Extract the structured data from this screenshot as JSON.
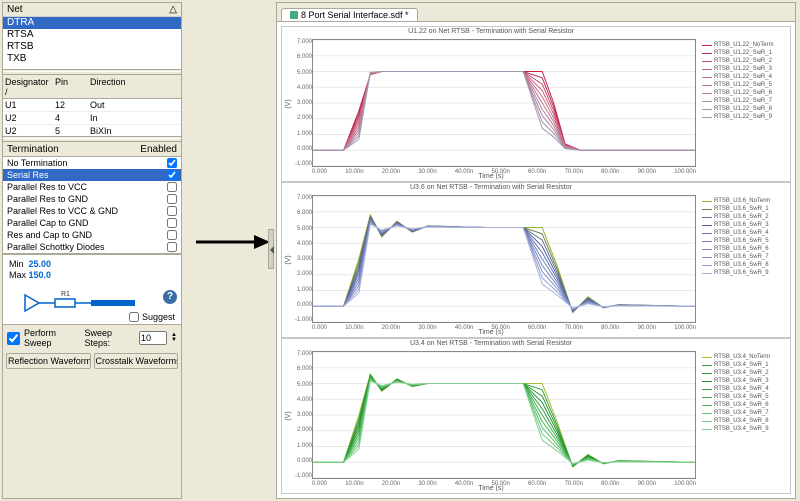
{
  "left": {
    "net_header": "Net",
    "nets": [
      "DTRA",
      "RTSA",
      "RTSB",
      "TXB"
    ],
    "net_selected": 0,
    "designator_headers": {
      "des": "Designator",
      "pin": "Pin",
      "dir": "Direction",
      "sort": "/"
    },
    "designator_rows": [
      {
        "des": "U1",
        "pin": "12",
        "dir": "Out"
      },
      {
        "des": "U2",
        "pin": "4",
        "dir": "In"
      },
      {
        "des": "U2",
        "pin": "5",
        "dir": "BiXIn"
      }
    ],
    "termination_headers": {
      "name": "Termination",
      "enabled": "Enabled"
    },
    "terminations": [
      {
        "name": "No Termination",
        "enabled": true,
        "selected": false
      },
      {
        "name": "Serial Res",
        "enabled": true,
        "selected": true
      },
      {
        "name": "Parallel Res to VCC",
        "enabled": false,
        "selected": false
      },
      {
        "name": "Parallel Res to GND",
        "enabled": false,
        "selected": false
      },
      {
        "name": "Parallel Res to VCC & GND",
        "enabled": false,
        "selected": false
      },
      {
        "name": "Parallel Cap to GND",
        "enabled": false,
        "selected": false
      },
      {
        "name": "Res and Cap to GND",
        "enabled": false,
        "selected": false
      },
      {
        "name": "Parallel Schottky Diodes",
        "enabled": false,
        "selected": false
      }
    ],
    "schematic": {
      "min_label": "Min",
      "min_val": "25.00",
      "max_label": "Max",
      "max_val": "150.0",
      "ref": "R1",
      "suggest_label": "Suggest",
      "suggest_checked": false
    },
    "sweep": {
      "perform_label": "Perform Sweep",
      "perform_checked": true,
      "steps_label": "Sweep Steps:",
      "steps_value": "10"
    },
    "buttons": {
      "reflection": "Reflection Waveforms...",
      "crosstalk": "Crosstalk Waveforms..."
    }
  },
  "right": {
    "tab_title": "8 Port Serial Interface.sdf *"
  },
  "chart_data": [
    {
      "type": "line",
      "title": "U1.22 on Net RTSB - Termination with Serial Resistor",
      "xlabel": "Time (s)",
      "ylabel": "(V)",
      "ylim": [
        -1.0,
        7.0
      ],
      "xlim": [
        0,
        100
      ],
      "yticks": [
        "7.000",
        "6.000",
        "5.000",
        "4.000",
        "3.000",
        "2.000",
        "1.000",
        "0.000",
        "-1.000"
      ],
      "xticks": [
        "0.000",
        "10.00n",
        "20.00n",
        "30.00n",
        "40.00n",
        "50.00n",
        "60.00n",
        "70.00n",
        "80.00n",
        "90.00n",
        "100.00n"
      ],
      "x": [
        0,
        8,
        12,
        15,
        18,
        25,
        35,
        45,
        55,
        60,
        63,
        66,
        70,
        80,
        100
      ],
      "values": [
        0,
        0,
        2.5,
        4.8,
        5.0,
        5.0,
        5.0,
        5.0,
        5.0,
        5.0,
        3.0,
        0.4,
        0.0,
        0.0,
        0.0
      ],
      "series_names": [
        "RTSB_U1.22_NoTerm",
        "RTSB_U1.22_SwR_1",
        "RTSB_U1.22_SwR_2",
        "RTSB_U1.22_SwR_3",
        "RTSB_U1.22_SwR_4",
        "RTSB_U1.22_SwR_5",
        "RTSB_U1.22_SwR_6",
        "RTSB_U1.22_SwR_7",
        "RTSB_U1.22_SwR_8",
        "RTSB_U1.22_SwR_9"
      ],
      "palette": [
        "#d02040",
        "#b03060",
        "#c85070",
        "#d06080",
        "#cc7088",
        "#c07890",
        "#b88098",
        "#b088a0",
        "#a890a8",
        "#a098b0"
      ]
    },
    {
      "type": "line",
      "title": "U3.6 on Net RTSB - Termination with Serial Resistor",
      "xlabel": "Time (s)",
      "ylabel": "(V)",
      "ylim": [
        -1.0,
        7.0
      ],
      "xlim": [
        0,
        100
      ],
      "yticks": [
        "7.000",
        "6.000",
        "5.000",
        "4.000",
        "3.000",
        "2.000",
        "1.000",
        "0.000",
        "-1.000"
      ],
      "xticks": [
        "0.000",
        "10.00n",
        "20.00n",
        "30.00n",
        "40.00n",
        "50.00n",
        "60.00n",
        "70.00n",
        "80.00n",
        "90.00n",
        "100.00n"
      ],
      "x": [
        0,
        8,
        12,
        15,
        18,
        22,
        26,
        30,
        45,
        55,
        60,
        64,
        68,
        72,
        76,
        80,
        100
      ],
      "values": [
        0,
        0,
        3.0,
        5.8,
        4.4,
        5.4,
        4.7,
        5.1,
        5.0,
        5.0,
        5.0,
        2.5,
        -0.4,
        0.6,
        -0.1,
        0.1,
        0.0
      ],
      "series_names": [
        "RTSB_U3.6_NoTerm",
        "RTSB_U3.6_SwR_1",
        "RTSB_U3.6_SwR_2",
        "RTSB_U3.6_SwR_3",
        "RTSB_U3.6_SwR_4",
        "RTSB_U3.6_SwR_5",
        "RTSB_U3.6_SwR_6",
        "RTSB_U3.6_SwR_7",
        "RTSB_U3.6_SwR_8",
        "RTSB_U3.6_SwR_9"
      ],
      "palette": [
        "#90b030",
        "#708050",
        "#607090",
        "#5060a0",
        "#6878b0",
        "#7080b8",
        "#7888c0",
        "#8090c8",
        "#98a0d0",
        "#a8b0d8"
      ]
    },
    {
      "type": "line",
      "title": "U3.4 on Net RTSB - Termination with Serial Resistor",
      "xlabel": "Time (s)",
      "ylabel": "(V)",
      "ylim": [
        -1.0,
        7.0
      ],
      "xlim": [
        0,
        100
      ],
      "yticks": [
        "7.000",
        "6.000",
        "5.000",
        "4.000",
        "3.000",
        "2.000",
        "1.000",
        "0.000",
        "-1.000"
      ],
      "xticks": [
        "0.000",
        "10.00n",
        "20.00n",
        "30.00n",
        "40.00n",
        "50.00n",
        "60.00n",
        "70.00n",
        "80.00n",
        "90.00n",
        "100.00n"
      ],
      "x": [
        0,
        8,
        12,
        15,
        18,
        22,
        26,
        30,
        45,
        55,
        60,
        64,
        68,
        72,
        76,
        80,
        100
      ],
      "values": [
        0,
        0,
        3.0,
        5.6,
        4.5,
        5.3,
        4.8,
        5.0,
        5.0,
        5.0,
        5.0,
        2.5,
        -0.3,
        0.5,
        -0.1,
        0.1,
        0.0
      ],
      "series_names": [
        "RTSB_U3.4_NoTerm",
        "RTSB_U3.4_SwR_1",
        "RTSB_U3.4_SwR_2",
        "RTSB_U3.4_SwR_3",
        "RTSB_U3.4_SwR_4",
        "RTSB_U3.4_SwR_5",
        "RTSB_U3.4_SwR_6",
        "RTSB_U3.4_SwR_7",
        "RTSB_U3.4_SwR_8",
        "RTSB_U3.4_SwR_9"
      ],
      "palette": [
        "#a0c030",
        "#40a040",
        "#309838",
        "#289030",
        "#34a044",
        "#40b050",
        "#50b860",
        "#60c070",
        "#70c880",
        "#80d090"
      ]
    }
  ]
}
